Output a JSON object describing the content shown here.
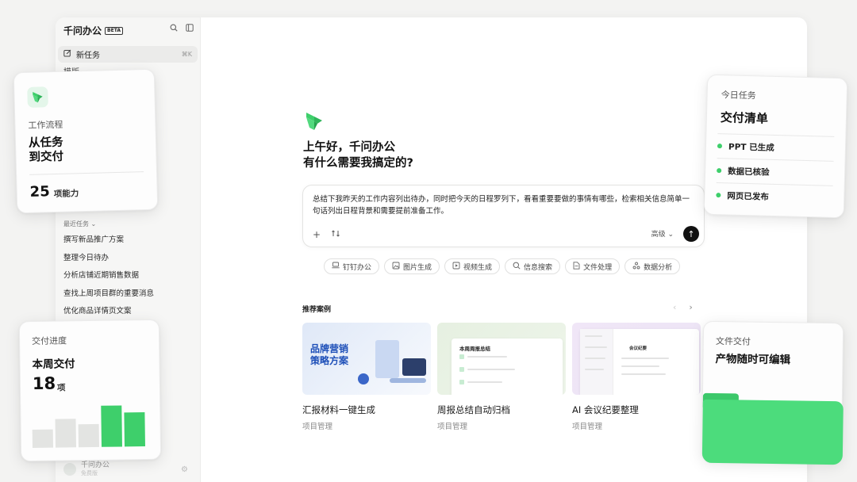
{
  "app": {
    "name": "千问办公",
    "badge": "BETA"
  },
  "sidebar": {
    "new_task_label": "新任务",
    "new_task_shortcut": "⌘K",
    "partial_item_label": "模版",
    "recent_title": "最近任务",
    "recent_tasks": [
      "撰写新品推广方案",
      "整理今日待办",
      "分析店铺近期销售数据",
      "查找上周项目群的重要消息",
      "优化商品详情页文案"
    ],
    "footer_name": "千问办公",
    "footer_plan": "免费版"
  },
  "main": {
    "greeting_line1": "上午好，千问办公",
    "greeting_line2": "有什么需要我搞定的?",
    "composer_text": "总结下我昨天的工作内容列出待办，同时把今天的日程罗列下，看看重要要做的事情有哪些，检索相关信息简单一句话列出日程背景和需要提前准备工作。",
    "advanced_label": "高级",
    "chips": [
      {
        "icon": "laptop-icon",
        "label": "钉钉办公"
      },
      {
        "icon": "image-icon",
        "label": "图片生成"
      },
      {
        "icon": "video-icon",
        "label": "视频生成"
      },
      {
        "icon": "search-icon",
        "label": "信息搜索"
      },
      {
        "icon": "file-icon",
        "label": "文件处理"
      },
      {
        "icon": "analysis-icon",
        "label": "数据分析"
      }
    ],
    "recommend_title": "推荐案例",
    "cases": [
      {
        "title": "汇报材料一键生成",
        "tag": "项目管理",
        "thumb_text": "品牌营销\n策略方案"
      },
      {
        "title": "周报总结自动归档",
        "tag": "项目管理",
        "thumb_text": "本周周报总结"
      },
      {
        "title": "AI 会议纪要整理",
        "tag": "项目管理",
        "thumb_text": "会议纪要"
      }
    ]
  },
  "cards": {
    "workflow": {
      "label": "工作流程",
      "headline_line1": "从任务",
      "headline_line2": "到交付",
      "count": "25",
      "count_unit": "项能力"
    },
    "today": {
      "label": "今日任务",
      "headline": "交付清单",
      "items": [
        "PPT 已生成",
        "数据已核验",
        "网页已发布"
      ]
    },
    "progress": {
      "label": "交付进度",
      "headline": "本周交付",
      "count": "18",
      "count_unit": "项",
      "bars": [
        0.42,
        0.66,
        0.52,
        0.95,
        0.78
      ]
    },
    "files": {
      "label": "文件交付",
      "headline": "产物随时可编辑"
    }
  },
  "colors": {
    "accent": "#3ecf6b",
    "bar_gray": "#e3e4e2"
  }
}
